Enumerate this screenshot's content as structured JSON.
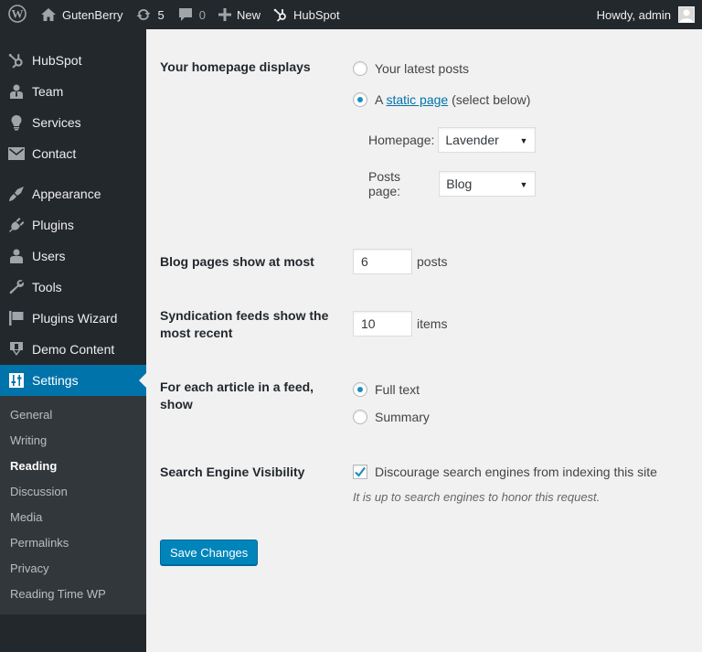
{
  "adminbar": {
    "site_name": "GutenBerry",
    "updates_count": "5",
    "comments_count": "0",
    "new_label": "New",
    "hubspot_label": "HubSpot",
    "howdy": "Howdy, admin"
  },
  "sidebar": {
    "items": [
      {
        "label": "HubSpot",
        "icon": "hubspot-icon"
      },
      {
        "label": "Team",
        "icon": "user-icon"
      },
      {
        "label": "Services",
        "icon": "lightbulb-icon"
      },
      {
        "label": "Contact",
        "icon": "envelope-icon"
      },
      {
        "label": "Appearance",
        "icon": "paintbrush-icon"
      },
      {
        "label": "Plugins",
        "icon": "plugin-icon"
      },
      {
        "label": "Users",
        "icon": "users-icon"
      },
      {
        "label": "Tools",
        "icon": "wrench-icon"
      },
      {
        "label": "Plugins Wizard",
        "icon": "flag-icon"
      },
      {
        "label": "Demo Content",
        "icon": "download-icon"
      },
      {
        "label": "Settings",
        "icon": "settings-icon"
      }
    ],
    "submenu": [
      "General",
      "Writing",
      "Reading",
      "Discussion",
      "Media",
      "Permalinks",
      "Privacy",
      "Reading Time WP"
    ],
    "current_submenu": "Reading"
  },
  "reading": {
    "homepage_displays": {
      "label": "Your homepage displays",
      "option_latest": "Your latest posts",
      "option_static_prefix": "A ",
      "option_static_link": "static page",
      "option_static_suffix": " (select below)",
      "selected": "static",
      "homepage_label": "Homepage:",
      "homepage_value": "Lavender",
      "posts_page_label": "Posts page:",
      "posts_page_value": "Blog"
    },
    "blog_pages": {
      "label": "Blog pages show at most",
      "value": "6",
      "suffix": "posts"
    },
    "syndication": {
      "label": "Syndication feeds show the most recent",
      "value": "10",
      "suffix": "items"
    },
    "feed_article": {
      "label": "For each article in a feed, show",
      "option_full": "Full text",
      "option_summary": "Summary",
      "selected": "full"
    },
    "search_visibility": {
      "label": "Search Engine Visibility",
      "checkbox_label": "Discourage search engines from indexing this site",
      "checked": true,
      "description": "It is up to search engines to honor this request."
    },
    "save_label": "Save Changes"
  },
  "colors": {
    "adminbar_bg": "#23282d",
    "accent": "#0073aa",
    "button": "#0085ba",
    "content_bg": "#f1f1f1"
  }
}
